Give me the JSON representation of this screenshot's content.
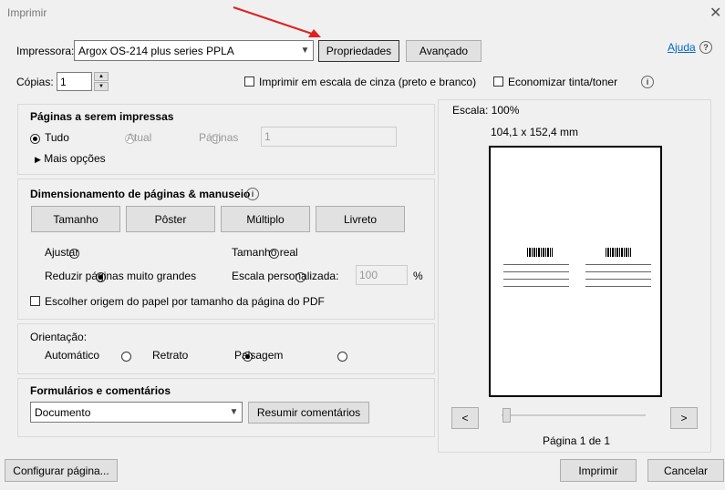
{
  "window": {
    "title": "Imprimir",
    "close_glyph": "✕"
  },
  "printer": {
    "label": "Impressora:",
    "selected": "Argox OS-214 plus series PPLA",
    "properties_button": "Propriedades",
    "advanced_button": "Avançado",
    "help_link": "Ajuda",
    "help_icon": "?"
  },
  "copies": {
    "label": "Cópias:",
    "value": "1",
    "grayscale_label": "Imprimir em escala de cinza (preto e branco)",
    "save_ink_label": "Economizar tinta/toner",
    "info_icon": "i"
  },
  "pages": {
    "heading": "Páginas a serem impressas",
    "all": "Tudo",
    "current": "Atual",
    "pages": "Páginas",
    "pages_value": "1",
    "more_options": "Mais opções"
  },
  "sizing": {
    "heading": "Dimensionamento de páginas & manuseio",
    "info_icon": "i",
    "tabs": [
      "Tamanho",
      "Pôster",
      "Múltiplo",
      "Livreto"
    ],
    "fit": "Ajustar",
    "actual_size": "Tamanho real",
    "shrink": "Reduzir páginas muito grandes",
    "custom_scale": "Escala personalizada:",
    "custom_scale_value": "100",
    "percent": "%",
    "choose_source": "Escolher origem do papel por tamanho da página do PDF"
  },
  "orientation": {
    "heading": "Orientação:",
    "auto": "Automático",
    "portrait": "Retrato",
    "landscape": "Paisagem"
  },
  "forms": {
    "heading": "Formulários e comentários",
    "selected": "Documento",
    "summarize_button": "Resumir comentários"
  },
  "preview": {
    "scale": "Escala: 100%",
    "dimensions": "104,1 x 152,4 mm",
    "prev": "<",
    "next": ">",
    "page_info": "Página 1 de 1"
  },
  "footer": {
    "page_setup": "Configurar página...",
    "print": "Imprimir",
    "cancel": "Cancelar"
  },
  "colors": {
    "annotation_arrow": "#e02020",
    "link": "#0066cc"
  }
}
